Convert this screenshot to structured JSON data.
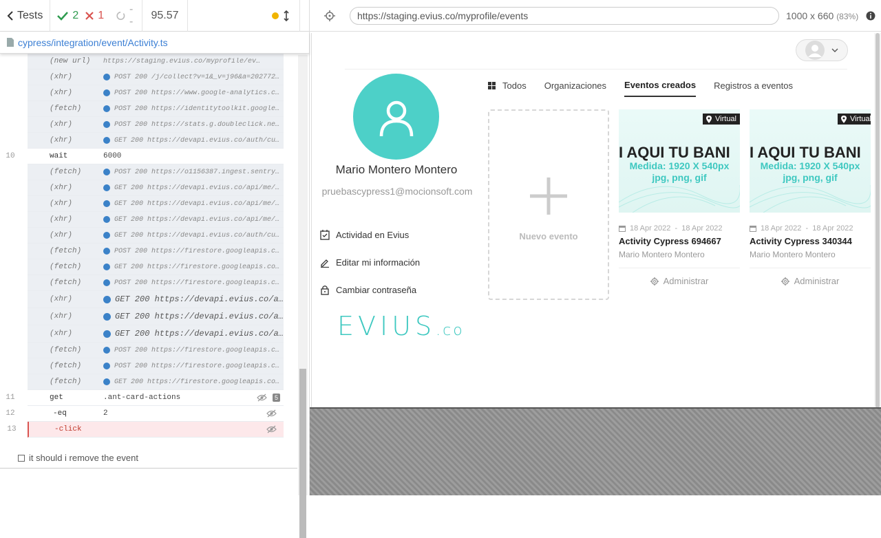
{
  "reporter": {
    "tests_label": "Tests",
    "passed": "2",
    "failed": "1",
    "pending": "--",
    "duration": "95.57",
    "spec_path": "cypress/integration/event/Activity.ts",
    "test_title": "it should i remove the event",
    "log": [
      {
        "name": "(new url)",
        "msg": "https://staging.evius.co/myprofile/ev…",
        "kind": "url"
      },
      {
        "name": "(xhr)",
        "msg": "POST 200 /j/collect?v=1&_v=j96&a=20277283…",
        "kind": "small"
      },
      {
        "name": "(xhr)",
        "msg": "POST 200 https://www.google-analytics.com…",
        "kind": "small"
      },
      {
        "name": "(fetch)",
        "msg": "POST 200 https://identitytoolkit.googleap…",
        "kind": "small"
      },
      {
        "name": "(xhr)",
        "msg": "POST 200 https://stats.g.doubleclick.net/…",
        "kind": "small"
      },
      {
        "name": "(xhr)",
        "msg": "GET 200 https://devapi.evius.co/auth/curr…",
        "kind": "small"
      },
      {
        "num": "10",
        "name": "wait",
        "msg": "6000",
        "kind": "cmd"
      },
      {
        "name": "(fetch)",
        "msg": "POST 200 https://o1156387.ingest.sentry.i…",
        "kind": "small"
      },
      {
        "name": "(xhr)",
        "msg": "GET 200 https://devapi.evius.co/api/me/co…",
        "kind": "small"
      },
      {
        "name": "(xhr)",
        "msg": "GET 200 https://devapi.evius.co/api/me/ev…",
        "kind": "small"
      },
      {
        "name": "(xhr)",
        "msg": "GET 200 https://devapi.evius.co/api/me/or…",
        "kind": "small"
      },
      {
        "name": "(xhr)",
        "msg": "GET 200 https://devapi.evius.co/auth/curr…",
        "kind": "small"
      },
      {
        "name": "(fetch)",
        "msg": "POST 200 https://firestore.googleapis.com…",
        "kind": "small"
      },
      {
        "name": "(fetch)",
        "msg": "GET 200 https://firestore.googleapis.com/…",
        "kind": "small"
      },
      {
        "name": "(fetch)",
        "msg": "POST 200 https://firestore.googleapis.com…",
        "kind": "small"
      },
      {
        "name": "(xhr)",
        "msg": "GET 200 https://devapi.evius.co/ap…",
        "kind": "big"
      },
      {
        "name": "(xhr)",
        "msg": "GET 200 https://devapi.evius.co/ap…",
        "kind": "big"
      },
      {
        "name": "(xhr)",
        "msg": "GET 200 https://devapi.evius.co/ap…",
        "kind": "big"
      },
      {
        "name": "(fetch)",
        "msg": "POST 200 https://firestore.googleapis.com…",
        "kind": "small"
      },
      {
        "name": "(fetch)",
        "msg": "POST 200 https://firestore.googleapis.com…",
        "kind": "small"
      },
      {
        "name": "(fetch)",
        "msg": "GET 200 https://firestore.googleapis.com/…",
        "kind": "small"
      },
      {
        "num": "11",
        "name": "get",
        "msg": ".ant-card-actions",
        "kind": "cmd",
        "badge": "5"
      },
      {
        "num": "12",
        "name": "-eq",
        "msg": "2",
        "kind": "cmd"
      },
      {
        "num": "13",
        "name": "-click",
        "msg": "",
        "kind": "err"
      }
    ]
  },
  "browser": {
    "url": "https://staging.evius.co/myprofile/events",
    "viewport": "1000 x 660",
    "scale": "(83%)"
  },
  "profile": {
    "name": "Mario Montero Montero",
    "email": "pruebascypress1@mocionsoft.com",
    "menu": [
      "Actividad en Evius",
      "Editar mi información",
      "Cambiar contraseña"
    ],
    "logo_main": "EVIUS",
    "logo_suffix": ".co"
  },
  "tabs": [
    "Todos",
    "Organizaciones",
    "Eventos creados",
    "Registros a eventos"
  ],
  "new_event_label": "Nuevo evento",
  "events": [
    {
      "badge": "Virtual",
      "banner_title": "I AQUI TU BANI",
      "banner_sub1": "Medida: 1920 X 540px",
      "banner_sub2": "jpg, png, gif",
      "date": "18 Apr 2022  -  18 Apr 2022",
      "title": "Activity Cypress 694667",
      "author": "Mario Montero Montero",
      "admin": "Administrar"
    },
    {
      "badge": "Virtual",
      "banner_title": "I AQUI TU BANI",
      "banner_sub1": "Medida: 1920 X 540px",
      "banner_sub2": "jpg, png, gif",
      "date": "18 Apr 2022  -  18 Apr 2022",
      "title": "Activity Cypress 340344",
      "author": "Mario Montero Montero",
      "admin": "Administrar"
    }
  ],
  "colors": {
    "accent": "#4dd0c8",
    "pass": "#2e9b4f",
    "fail": "#d9534f",
    "link": "#3b7fd4"
  }
}
